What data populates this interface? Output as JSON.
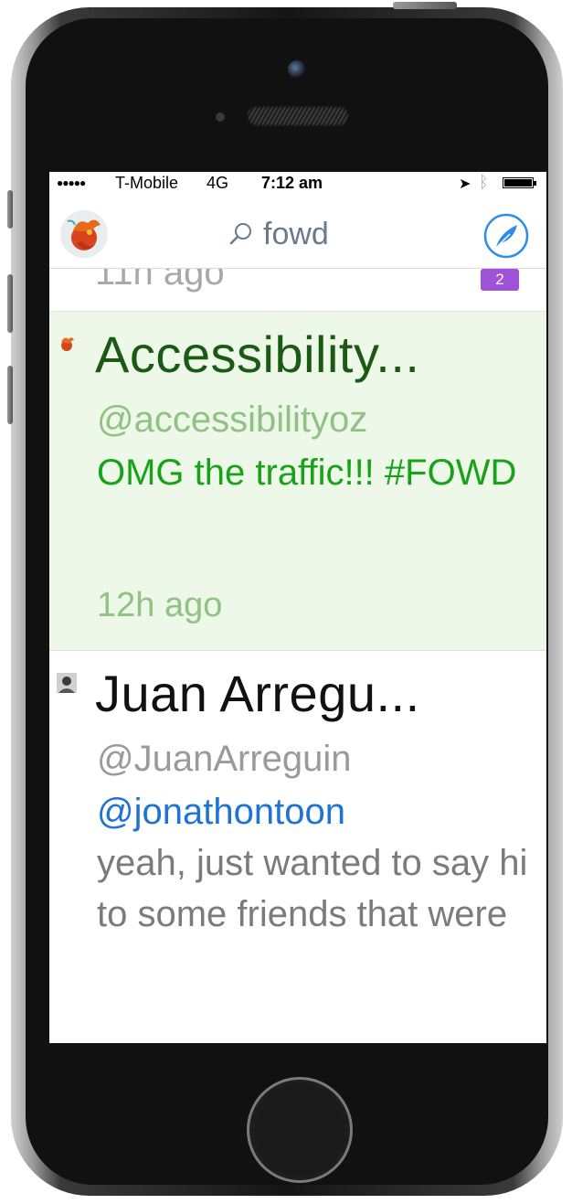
{
  "status_bar": {
    "signal_dots": "●●●●●",
    "carrier": "T-Mobile",
    "network": "4G",
    "time": "7:12 am",
    "location_icon": "location-arrow-icon",
    "bluetooth_icon": "bluetooth-icon",
    "battery_level": 1.0
  },
  "nav": {
    "avatar_icon": "user-avatar-phoenix",
    "search_icon": "search-icon",
    "search_query": "fowd",
    "compose_icon": "compose-feather-icon",
    "accent_color": "#2d8de8"
  },
  "feed": {
    "previous": {
      "time": "11h ago",
      "badge": "2",
      "badge_color": "#9e52d6"
    },
    "tweets": [
      {
        "name": "Accessibility...",
        "handle": "@accessibilityoz",
        "body": "OMG the traffic!!! #FOWD",
        "time": "12h ago",
        "highlighted": true
      },
      {
        "name": "Juan Arregu...",
        "handle": "@JuanArreguin",
        "mention": "@jonathontoon",
        "body": "yeah, just wanted to say hi to some friends that were",
        "highlighted": false
      }
    ]
  }
}
